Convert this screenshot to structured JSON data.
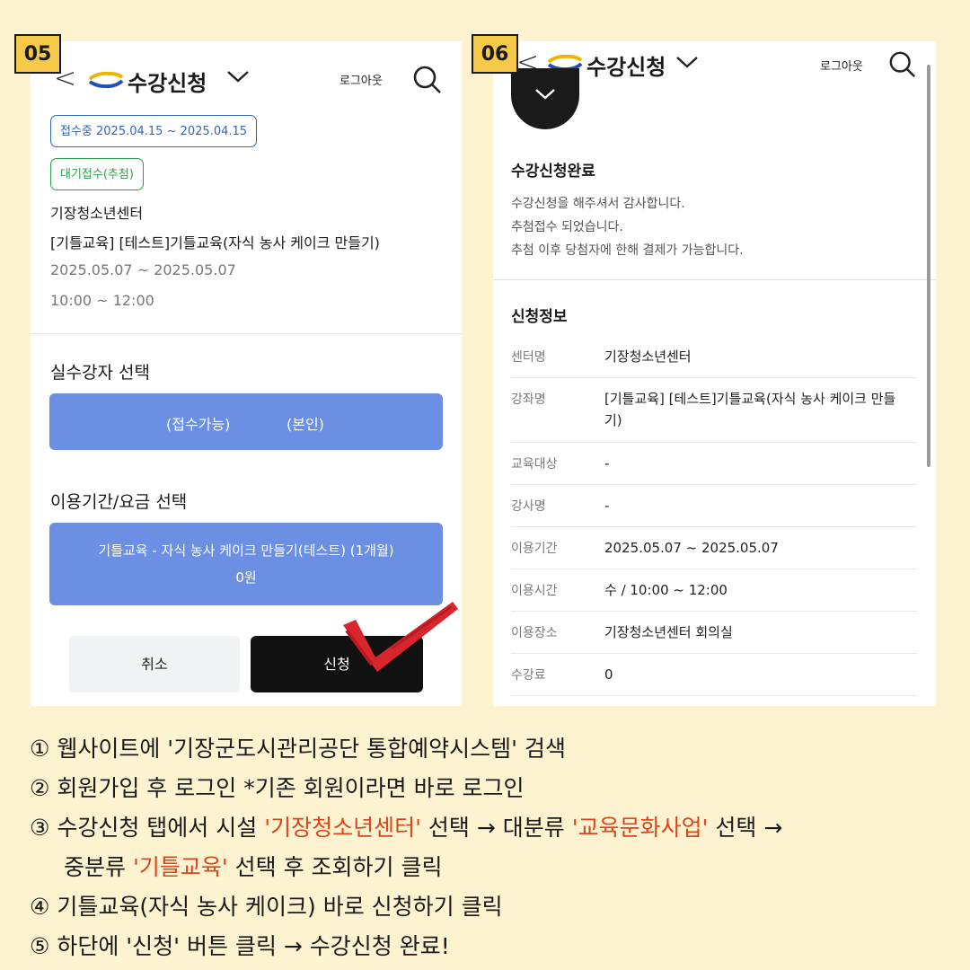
{
  "step05": {
    "badge": "05",
    "header": {
      "title": "수강신청",
      "logout": "로그아웃"
    },
    "status_chip": "접수중 2025.04.15 ~ 2025.04.15",
    "type_chip": "대기접수(추첨)",
    "center": "기장청소년센터",
    "course": "[기틀교육] [테스트]기틀교육(자식 농사 케이크 만들기)",
    "period": "2025.05.07 ~ 2025.05.07",
    "time": "10:00 ~ 12:00",
    "learner_section": {
      "title": "실수강자 선택",
      "status": "(접수가능)",
      "who": "(본인)"
    },
    "fee_section": {
      "title": "이용기간/요금 선택",
      "option_line1": "기틀교육 - 자식 농사 케이크 만들기(테스트) (1개월)",
      "option_line2": "0원"
    },
    "buttons": {
      "cancel": "취소",
      "apply": "신청"
    }
  },
  "step06": {
    "badge": "06",
    "header": {
      "title": "수강신청",
      "logout": "로그아웃"
    },
    "complete": {
      "title": "수강신청완료",
      "line1": "수강신청을 해주셔서 감사합니다.",
      "line2": "추첨접수 되었습니다.",
      "line3": "추첨 이후 당첨자에 한해 결제가 가능합니다."
    },
    "info": {
      "title": "신청정보",
      "rows": [
        {
          "label": "센터명",
          "value": "기장청소년센터"
        },
        {
          "label": "강좌명",
          "value": "[기틀교육] [테스트]기틀교육(자식 농사 케이크 만들기)"
        },
        {
          "label": "교육대상",
          "value": "-"
        },
        {
          "label": "강사명",
          "value": "-"
        },
        {
          "label": "이용기간",
          "value": "2025.05.07 ~ 2025.05.07"
        },
        {
          "label": "이용시간",
          "value": "수 / 10:00 ~ 12:00"
        },
        {
          "label": "이용장소",
          "value": "기장청소년센터 회의실"
        },
        {
          "label": "수강료",
          "value": "0"
        }
      ]
    }
  },
  "instructions": {
    "s1": "① 웹사이트에 '기장군도시관리공단 통합예약시스템' 검색",
    "s2": "② 회원가입 후 로그인   *기존 회원이라면 바로 로그인",
    "s3_a": "③ 수강신청 탭에서 시설 ",
    "s3_hl1": "'기장청소년센터'",
    "s3_b": " 선택 → 대분류 ",
    "s3_hl2": "'교육문화사업'",
    "s3_c": " 선택 →",
    "s3_d": "중분류 ",
    "s3_hl3": "'기틀교육'",
    "s3_e": " 선택 후 조회하기 클릭",
    "s4": "④ 기틀교육(자식 농사 케이크) 바로 신청하기 클릭",
    "s5": "⑤ 하단에 '신청' 버튼 클릭 → 수강신청 완료!"
  },
  "colors": {
    "background": "#fdf3d0",
    "badge": "#f7c948",
    "primary_blue": "#6a8fe3",
    "chip_blue": "#3563b8",
    "chip_green": "#2e9e4d",
    "highlight": "#d9461c",
    "checkmark": "#d8262c"
  },
  "icons": [
    "back-arrow-icon",
    "logo-icon",
    "chevron-down-icon",
    "search-icon",
    "checkmark-icon"
  ]
}
